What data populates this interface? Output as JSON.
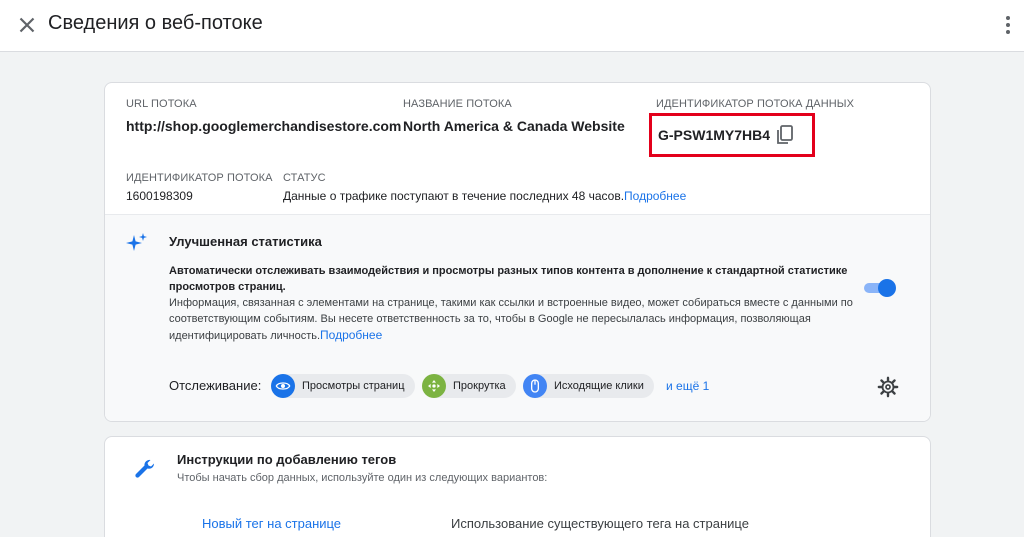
{
  "header": {
    "title": "Сведения о веб-потоке",
    "close_icon": "close-icon",
    "more_icon": "more-vert-icon"
  },
  "details": {
    "url_label": "URL потока",
    "url_value": "http://shop.googlemerchandisestore.com",
    "name_label": "Название потока",
    "name_value": "North America & Canada Website",
    "measurement_label": "Идентификатор потока данных",
    "measurement_value": "G-PSW1MY7HB4",
    "copy_icon": "copy-icon",
    "stream_id_label": "Идентификатор потока",
    "stream_id_value": "1600198309",
    "status_label": "Статус",
    "status_value": "Данные о трафике поступают в течение последних 48 часов.",
    "status_link": "Подробнее"
  },
  "enhanced": {
    "icon": "sparkle-icon",
    "title": "Улучшенная статистика",
    "desc_bold": "Автоматически отслеживать взаимодействия и просмотры разных типов контента в дополнение к стандартной статистике просмотров страниц.",
    "desc_text": "Информация, связанная с элементами на странице, такими как ссылки и встроенные видео, может собираться вместе с данными по соответствующим событиям. Вы несете ответственность за то, чтобы в Google не пересылалась информация, позволяющая идентифицировать личность.",
    "desc_link": "Подробнее",
    "toggle_on": true,
    "tracking_label": "Отслеживание:",
    "chips": [
      {
        "label": "Просмотры страниц",
        "icon": "eye-icon",
        "color": "#1a73e8"
      },
      {
        "label": "Прокрутка",
        "icon": "scroll-icon",
        "color": "#7cb342"
      },
      {
        "label": "Исходящие клики",
        "icon": "mouse-icon",
        "color": "#4285f4"
      }
    ],
    "more_link": "и ещё 1",
    "settings_icon": "gear-icon"
  },
  "tagging": {
    "icon": "wrench-icon",
    "title": "Инструкции по добавлению тегов",
    "subtitle": "Чтобы начать сбор данных, используйте один из следующих вариантов:",
    "option_new": "Новый тег на странице",
    "option_existing": "Использование существующего тега на странице"
  },
  "colors": {
    "accent": "#1a73e8",
    "highlight_box": "#e3001b",
    "background": "#f1f3f4"
  }
}
